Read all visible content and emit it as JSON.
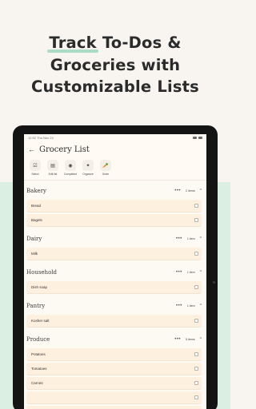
{
  "headline": {
    "line1_highlight": "Track",
    "line1_rest": " To-Dos &",
    "line2": "Groceries with",
    "line3": "Customizable Lists"
  },
  "status": {
    "time": "12:52",
    "date": "Thu Nov 23"
  },
  "app": {
    "back_icon": "arrow-left-icon",
    "title": "Grocery List"
  },
  "toolbar": [
    {
      "label": "Select",
      "icon": "checkbox-icon",
      "glyph": "☑"
    },
    {
      "label": "Edit list",
      "icon": "edit-list-icon",
      "glyph": "▤"
    },
    {
      "label": "Completed",
      "icon": "eye-icon",
      "glyph": "◉"
    },
    {
      "label": "Organize",
      "icon": "sparkle-icon",
      "glyph": "✦"
    },
    {
      "label": "Order",
      "icon": "carrot-icon",
      "glyph": "🥕"
    }
  ],
  "sections": [
    {
      "name": "Bakery",
      "count": "2 items",
      "items": [
        "Bread",
        "Bagels"
      ]
    },
    {
      "name": "Dairy",
      "count": "1 item",
      "items": [
        "Milk"
      ]
    },
    {
      "name": "Household",
      "count": "1 item",
      "items": [
        "Dish soap"
      ]
    },
    {
      "name": "Pantry",
      "count": "1 item",
      "items": [
        "Kosher salt"
      ]
    },
    {
      "name": "Produce",
      "count": "5 items",
      "items": [
        "Potatoes",
        "Tomatoes",
        "Carrots",
        "",
        ""
      ]
    }
  ],
  "colors": {
    "background": "#f8f4f0",
    "mint": "#dcefe3",
    "row": "#fdf0de",
    "highlight": "#a9dcc2"
  }
}
